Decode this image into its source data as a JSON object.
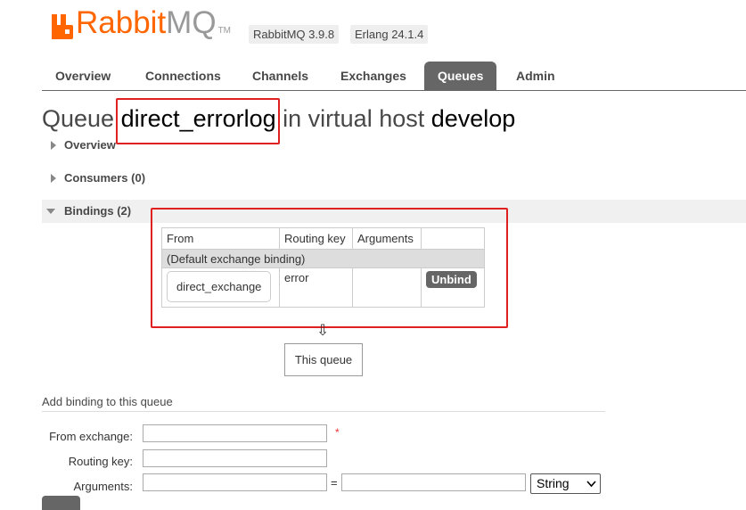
{
  "header": {
    "logo_rabbit": "Rabbit",
    "logo_mq": "MQ",
    "logo_tm": "TM",
    "rabbitmq_version": "RabbitMQ 3.9.8",
    "erlang_version": "Erlang 24.1.4"
  },
  "tabs": [
    "Overview",
    "Connections",
    "Channels",
    "Exchanges",
    "Queues",
    "Admin"
  ],
  "active_tab": "Queues",
  "title": {
    "prefix": "Queue ",
    "queue_name": "direct_errorlog",
    "middle": " in virtual host ",
    "vhost": "develop"
  },
  "sections": {
    "overview": "Overview",
    "consumers": "Consumers (0)",
    "bindings": "Bindings (2)"
  },
  "bindings_table": {
    "columns": [
      "From",
      "Routing key",
      "Arguments",
      ""
    ],
    "group_row": "(Default exchange binding)",
    "rows": [
      {
        "from": "direct_exchange",
        "routing_key": "error",
        "arguments": "",
        "action": "Unbind"
      }
    ]
  },
  "arrow_glyph": "⇩",
  "this_queue": "This queue",
  "add_binding": {
    "heading": "Add binding to this queue",
    "from_exchange_label": "From exchange:",
    "routing_key_label": "Routing key:",
    "arguments_label": "Arguments:",
    "required_mark": "*",
    "equals": "=",
    "type_select": "String"
  },
  "colors": {
    "brand_orange": "#ff6600",
    "active_tab": "#666666",
    "highlight_box": "#e02020"
  }
}
